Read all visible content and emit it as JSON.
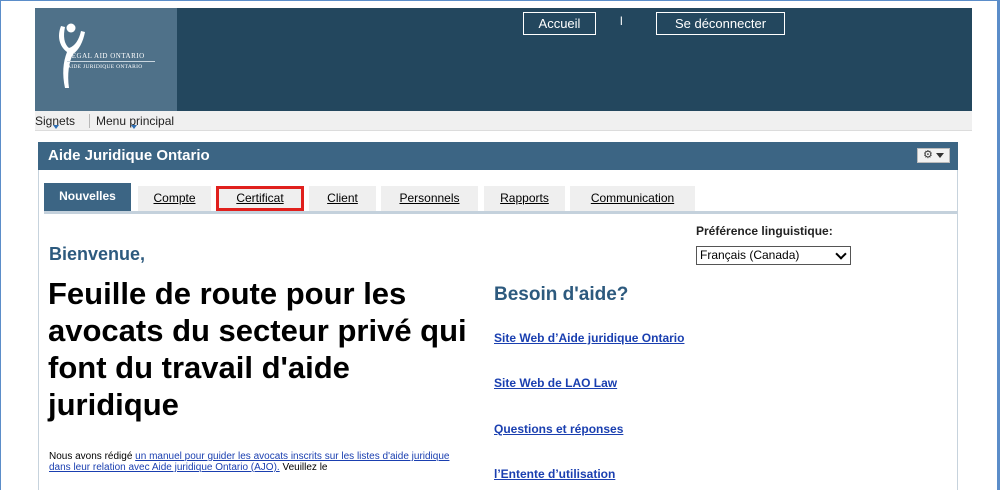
{
  "header": {
    "logo_line1": "LEGAL AID ONTARIO",
    "logo_line2": "AIDE JURIDIQUE ONTARIO",
    "home_label": "Accueil",
    "separator": "l",
    "logout_label": "Se déconnecter"
  },
  "toolbar": {
    "bookmarks_label": "Signets",
    "main_menu_label": "Menu principal"
  },
  "panel": {
    "title": "Aide Juridique Ontario"
  },
  "tabs": [
    {
      "label": "Nouvelles",
      "active": true
    },
    {
      "label": "Compte",
      "active": false
    },
    {
      "label": "Certificat",
      "active": false,
      "highlighted": true
    },
    {
      "label": "Client",
      "active": false
    },
    {
      "label": "Personnels",
      "active": false
    },
    {
      "label": "Rapports",
      "active": false
    },
    {
      "label": "Communication",
      "active": false
    }
  ],
  "language": {
    "label": "Préférence linguistique:",
    "selected": "Français (Canada)"
  },
  "content": {
    "welcome": "Bienvenue,",
    "heading": "Feuille de route pour les avocats du secteur privé qui font du travail d'aide juridique",
    "intro_prefix": "Nous avons rédigé ",
    "intro_link": "un manuel pour guider les avocats inscrits sur les listes d'aide juridique dans leur relation avec Aide juridique Ontario (AJO).",
    "intro_suffix": " Veuillez le"
  },
  "help": {
    "title": "Besoin d'aide?",
    "links": [
      "Site Web d’Aide juridique Ontario",
      "Site Web de LAO Law",
      "Questions et réponses",
      "l’Entente d’utilisation"
    ]
  },
  "colors": {
    "header_bg": "#23475e",
    "logo_bg": "#4f7189",
    "panel_head": "#3c6584",
    "accent_text": "#2d5a7e",
    "link": "#1a3fb0",
    "highlight": "#e0201d"
  }
}
